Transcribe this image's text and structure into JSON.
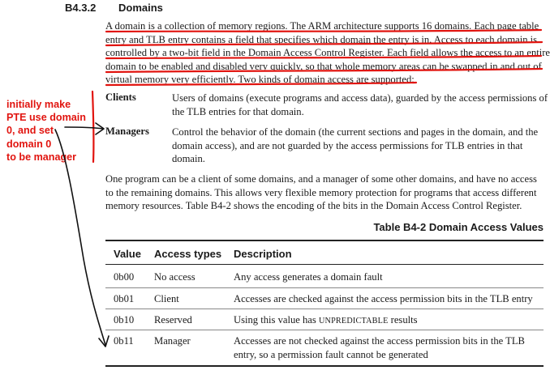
{
  "section": {
    "number": "B4.3.2",
    "title": "Domains"
  },
  "intro_lines": [
    "A domain is a collection of memory regions. The ARM architecture supports 16 domains. Each page table",
    "entry and TLB entry contains a field that specifies which domain the entry is in. Access to each domain is",
    "controlled by a two-bit field in the Domain Access Control Register. Each field allows the access to an entire",
    "domain to be enabled and disabled very quickly, so that whole memory areas can be swapped in and out of",
    "virtual memory very efficiently. Two kinds of domain access are supported:"
  ],
  "definitions": [
    {
      "term": "Clients",
      "lines": [
        "Users of domains (execute programs and access data), guarded by the access permissions of",
        "the TLB entries for that domain."
      ]
    },
    {
      "term": "Managers",
      "lines": [
        "Control the behavior of the domain (the current sections and pages in the domain, and the",
        "domain access), and are not guarded by the access permissions for TLB entries in that",
        "domain."
      ]
    }
  ],
  "outro_lines": [
    "One program can be a client of some domains, and a manager of some other domains, and have no access",
    "to the remaining domains. This allows very flexible memory protection for programs that access different",
    "memory resources. Table B4-2 shows the encoding of the bits in the Domain Access Control Register."
  ],
  "table": {
    "caption": "Table B4-2 Domain Access Values",
    "headers": {
      "value": "Value",
      "access": "Access types",
      "description": "Description"
    },
    "rows": [
      {
        "value": "0b00",
        "access": "No access",
        "description": [
          "Any access generates a domain fault"
        ]
      },
      {
        "value": "0b01",
        "access": "Client",
        "description": [
          "Accesses are checked against the access permission bits in the TLB entry"
        ]
      },
      {
        "value": "0b10",
        "access": "Reserved",
        "description_parts": [
          "Using this value has ",
          "UNPREDICTABLE",
          " results"
        ]
      },
      {
        "value": "0b11",
        "access": "Manager",
        "description": [
          "Accesses are not checked against the access permission bits in the TLB",
          "entry, so a permission fault cannot be generated"
        ]
      }
    ]
  },
  "annotation": {
    "lines": [
      "initially make",
      "PTE use domain",
      "0, and set",
      "domain 0",
      "to be manager"
    ],
    "color": "#e1140f"
  }
}
